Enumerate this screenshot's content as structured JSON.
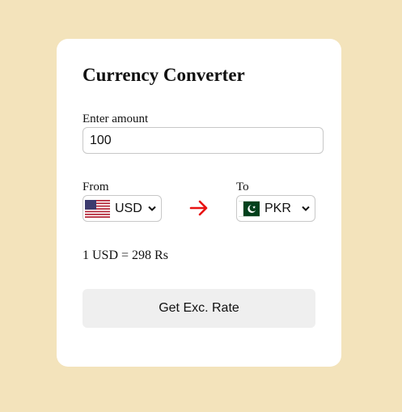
{
  "app": {
    "title": "Currency Converter"
  },
  "amount": {
    "label": "Enter amount",
    "value": "100"
  },
  "from": {
    "label": "From",
    "currency": "USD",
    "flag_icon": "us-flag-icon"
  },
  "to": {
    "label": "To",
    "currency": "PKR",
    "flag_icon": "pk-flag-icon"
  },
  "exchange_icon": "arrow-right-icon",
  "rate_text": "1 USD = 298 Rs",
  "button": {
    "label": "Get Exc. Rate"
  },
  "colors": {
    "background": "#f3e3bb",
    "card": "#ffffff",
    "arrow": "#e81313",
    "button_bg": "#efefef"
  }
}
